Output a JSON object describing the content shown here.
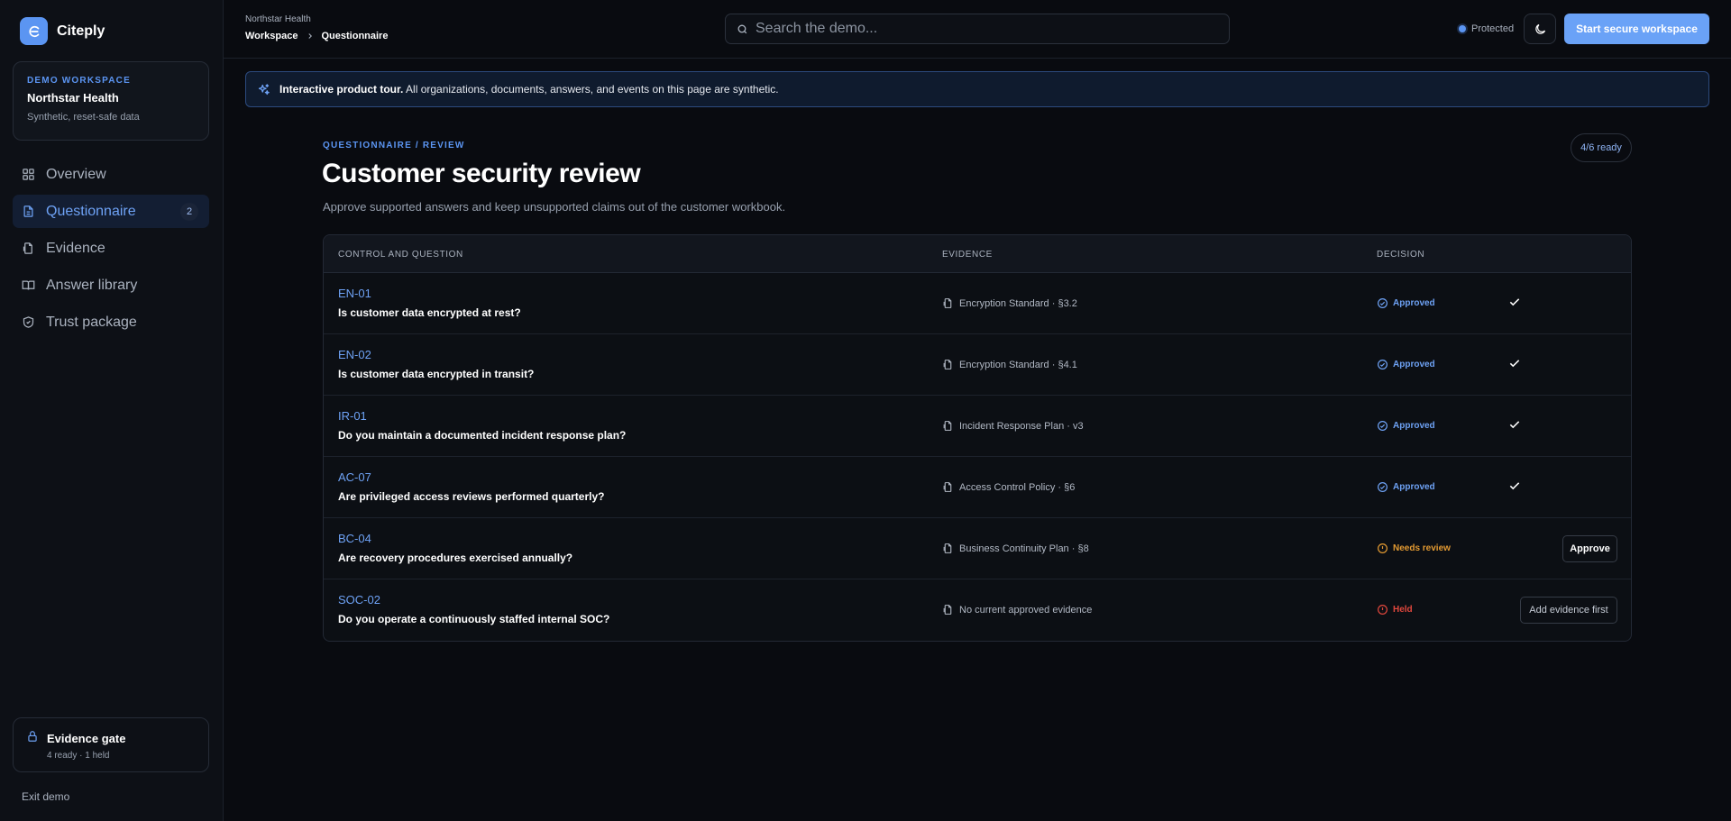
{
  "app": {
    "name": "Citeply"
  },
  "workspace": {
    "kicker": "DEMO WORKSPACE",
    "name": "Northstar Health",
    "subtitle": "Synthetic, reset-safe data"
  },
  "nav": [
    {
      "label": "Overview",
      "icon": "grid-icon"
    },
    {
      "label": "Questionnaire",
      "icon": "document-icon",
      "badge": "2",
      "active": true
    },
    {
      "label": "Evidence",
      "icon": "file-icon"
    },
    {
      "label": "Answer library",
      "icon": "book-icon"
    },
    {
      "label": "Trust package",
      "icon": "shield-icon"
    }
  ],
  "evidence_gate": {
    "title": "Evidence gate",
    "subtitle": "4 ready · 1 held"
  },
  "exit_label": "Exit demo",
  "header": {
    "org": "Northstar Health",
    "breadcrumb": [
      "Workspace",
      "Questionnaire"
    ],
    "search_placeholder": "Search the demo...",
    "protected_label": "Protected",
    "start_label": "Start secure workspace"
  },
  "banner": {
    "bold": "Interactive product tour.",
    "text": " All organizations, documents, answers, and events on this page are synthetic."
  },
  "page": {
    "kicker": "QUESTIONNAIRE / REVIEW",
    "title": "Customer security review",
    "subtitle": "Approve supported answers and keep unsupported claims out of the customer workbook.",
    "ready_count": "4/6 ready"
  },
  "table": {
    "headers": [
      "CONTROL AND QUESTION",
      "EVIDENCE",
      "DECISION"
    ],
    "rows": [
      {
        "code": "EN-01",
        "question": "Is customer data encrypted at rest?",
        "evidence": "Encryption Standard · §3.2",
        "status": "Approved",
        "state": "approved"
      },
      {
        "code": "EN-02",
        "question": "Is customer data encrypted in transit?",
        "evidence": "Encryption Standard · §4.1",
        "status": "Approved",
        "state": "approved"
      },
      {
        "code": "IR-01",
        "question": "Do you maintain a documented incident response plan?",
        "evidence": "Incident Response Plan · v3",
        "status": "Approved",
        "state": "approved"
      },
      {
        "code": "AC-07",
        "question": "Are privileged access reviews performed quarterly?",
        "evidence": "Access Control Policy · §6",
        "status": "Approved",
        "state": "approved"
      },
      {
        "code": "BC-04",
        "question": "Are recovery procedures exercised annually?",
        "evidence": "Business Continuity Plan · §8",
        "status": "Needs review",
        "state": "review",
        "action": "Approve"
      },
      {
        "code": "SOC-02",
        "question": "Do you operate a continuously staffed internal SOC?",
        "evidence": "No current approved evidence",
        "status": "Held",
        "state": "held",
        "action": "Add evidence first"
      }
    ]
  },
  "colors": {
    "accent": "#5b95f2",
    "review": "#e39a32",
    "held": "#e0473d",
    "background": "#090b10"
  }
}
